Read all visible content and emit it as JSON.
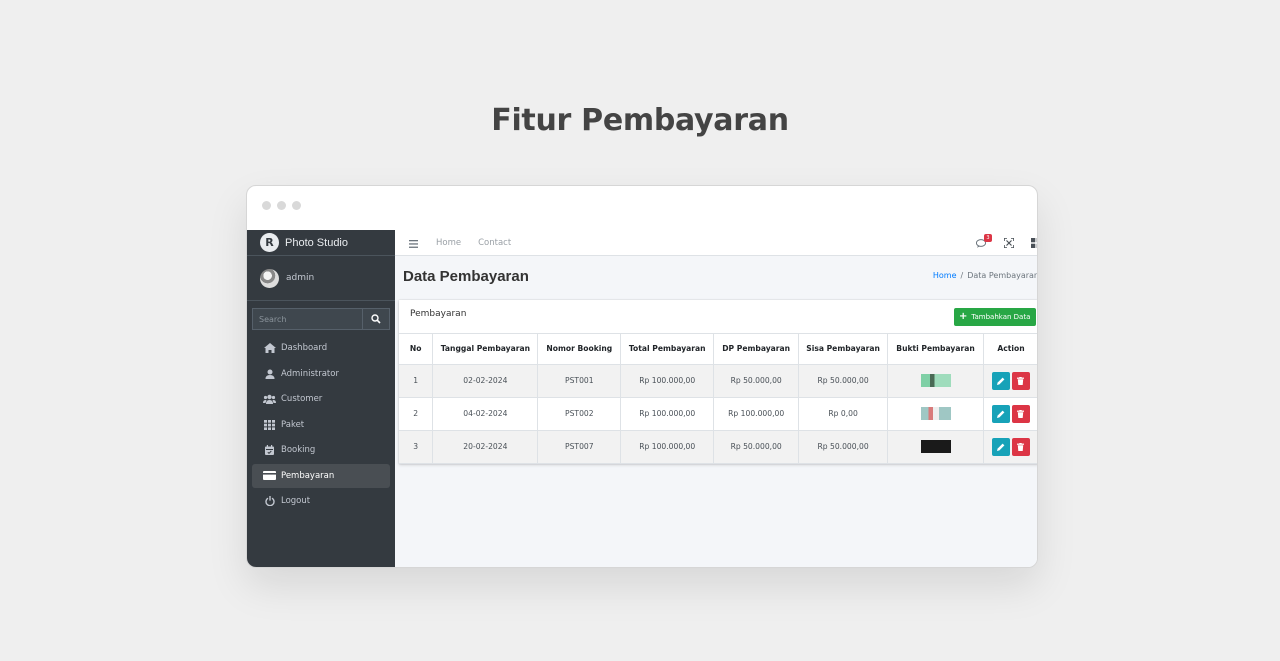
{
  "page": {
    "heading": "Fitur Pembayaran"
  },
  "sidebar": {
    "brand": "Photo Studio",
    "brand_logo_letter": "R",
    "user": "admin",
    "search_placeholder": "Search",
    "items": [
      {
        "label": "Dashboard",
        "icon": "home-icon",
        "active": false
      },
      {
        "label": "Administrator",
        "icon": "user-icon",
        "active": false
      },
      {
        "label": "Customer",
        "icon": "users-icon",
        "active": false
      },
      {
        "label": "Paket",
        "icon": "grid-icon",
        "active": false
      },
      {
        "label": "Booking",
        "icon": "calendar-icon",
        "active": false
      },
      {
        "label": "Pembayaran",
        "icon": "credit-card-icon",
        "active": true
      },
      {
        "label": "Logout",
        "icon": "power-icon",
        "active": false
      }
    ]
  },
  "topbar": {
    "links": [
      "Home",
      "Contact"
    ],
    "notification_count": "3"
  },
  "content": {
    "title": "Data Pembayaran",
    "breadcrumb": {
      "home": "Home",
      "separator": "/",
      "current": "Data Pembayaran"
    }
  },
  "card": {
    "title": "Pembayaran",
    "add_button": "Tambahkan Data",
    "columns": [
      "No",
      "Tanggal Pembayaran",
      "Nomor Booking",
      "Total Pembayaran",
      "DP Pembayaran",
      "Sisa Pembayaran",
      "Bukti Pembayaran",
      "Action"
    ],
    "rows": [
      {
        "no": "1",
        "tanggal": "02-02-2024",
        "nomor": "PST001",
        "total": "Rp 100.000,00",
        "dp": "Rp 50.000,00",
        "sisa": "Rp 50.000,00",
        "bukti": "green"
      },
      {
        "no": "2",
        "tanggal": "04-02-2024",
        "nomor": "PST002",
        "total": "Rp 100.000,00",
        "dp": "Rp 100.000,00",
        "sisa": "Rp 0,00",
        "bukti": "photo"
      },
      {
        "no": "3",
        "tanggal": "20-02-2024",
        "nomor": "PST007",
        "total": "Rp 100.000,00",
        "dp": "Rp 50.000,00",
        "sisa": "Rp 50.000,00",
        "bukti": "dark"
      }
    ]
  },
  "colors": {
    "sidebar": "#343a40",
    "success": "#28a745",
    "info": "#17a2b8",
    "danger": "#dc3545",
    "link": "#007bff"
  }
}
